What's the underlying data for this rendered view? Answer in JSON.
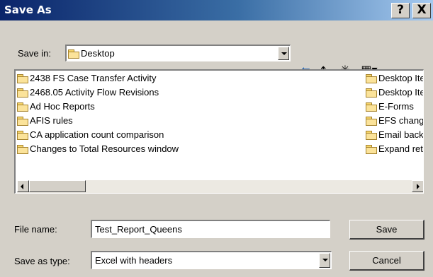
{
  "window": {
    "title": "Save As",
    "help_label": "?",
    "close_label": "X"
  },
  "save_in": {
    "label": "Save in:",
    "value": "Desktop"
  },
  "toolbar": {
    "back_glyph": "⇦",
    "up_glyph": "⬑",
    "new_folder_glyph": "✳",
    "views_glyph": "▦▾"
  },
  "files": {
    "left": [
      "2438 FS Case Transfer Activity",
      "2468.05 Activity Flow Revisions",
      "Ad Hoc Reports",
      "AFIS rules",
      "CA application count comparison",
      "Changes to Total Resources window"
    ],
    "right": [
      "Desktop Ite",
      "Desktop Ite",
      "E-Forms",
      "EFS change",
      "Email backu",
      "Expand ret"
    ]
  },
  "file_name": {
    "label": "File name:",
    "value": "Test_Report_Queens"
  },
  "save_type": {
    "label": "Save as type:",
    "value": "Excel with headers"
  },
  "buttons": {
    "save": "Save",
    "cancel": "Cancel"
  }
}
